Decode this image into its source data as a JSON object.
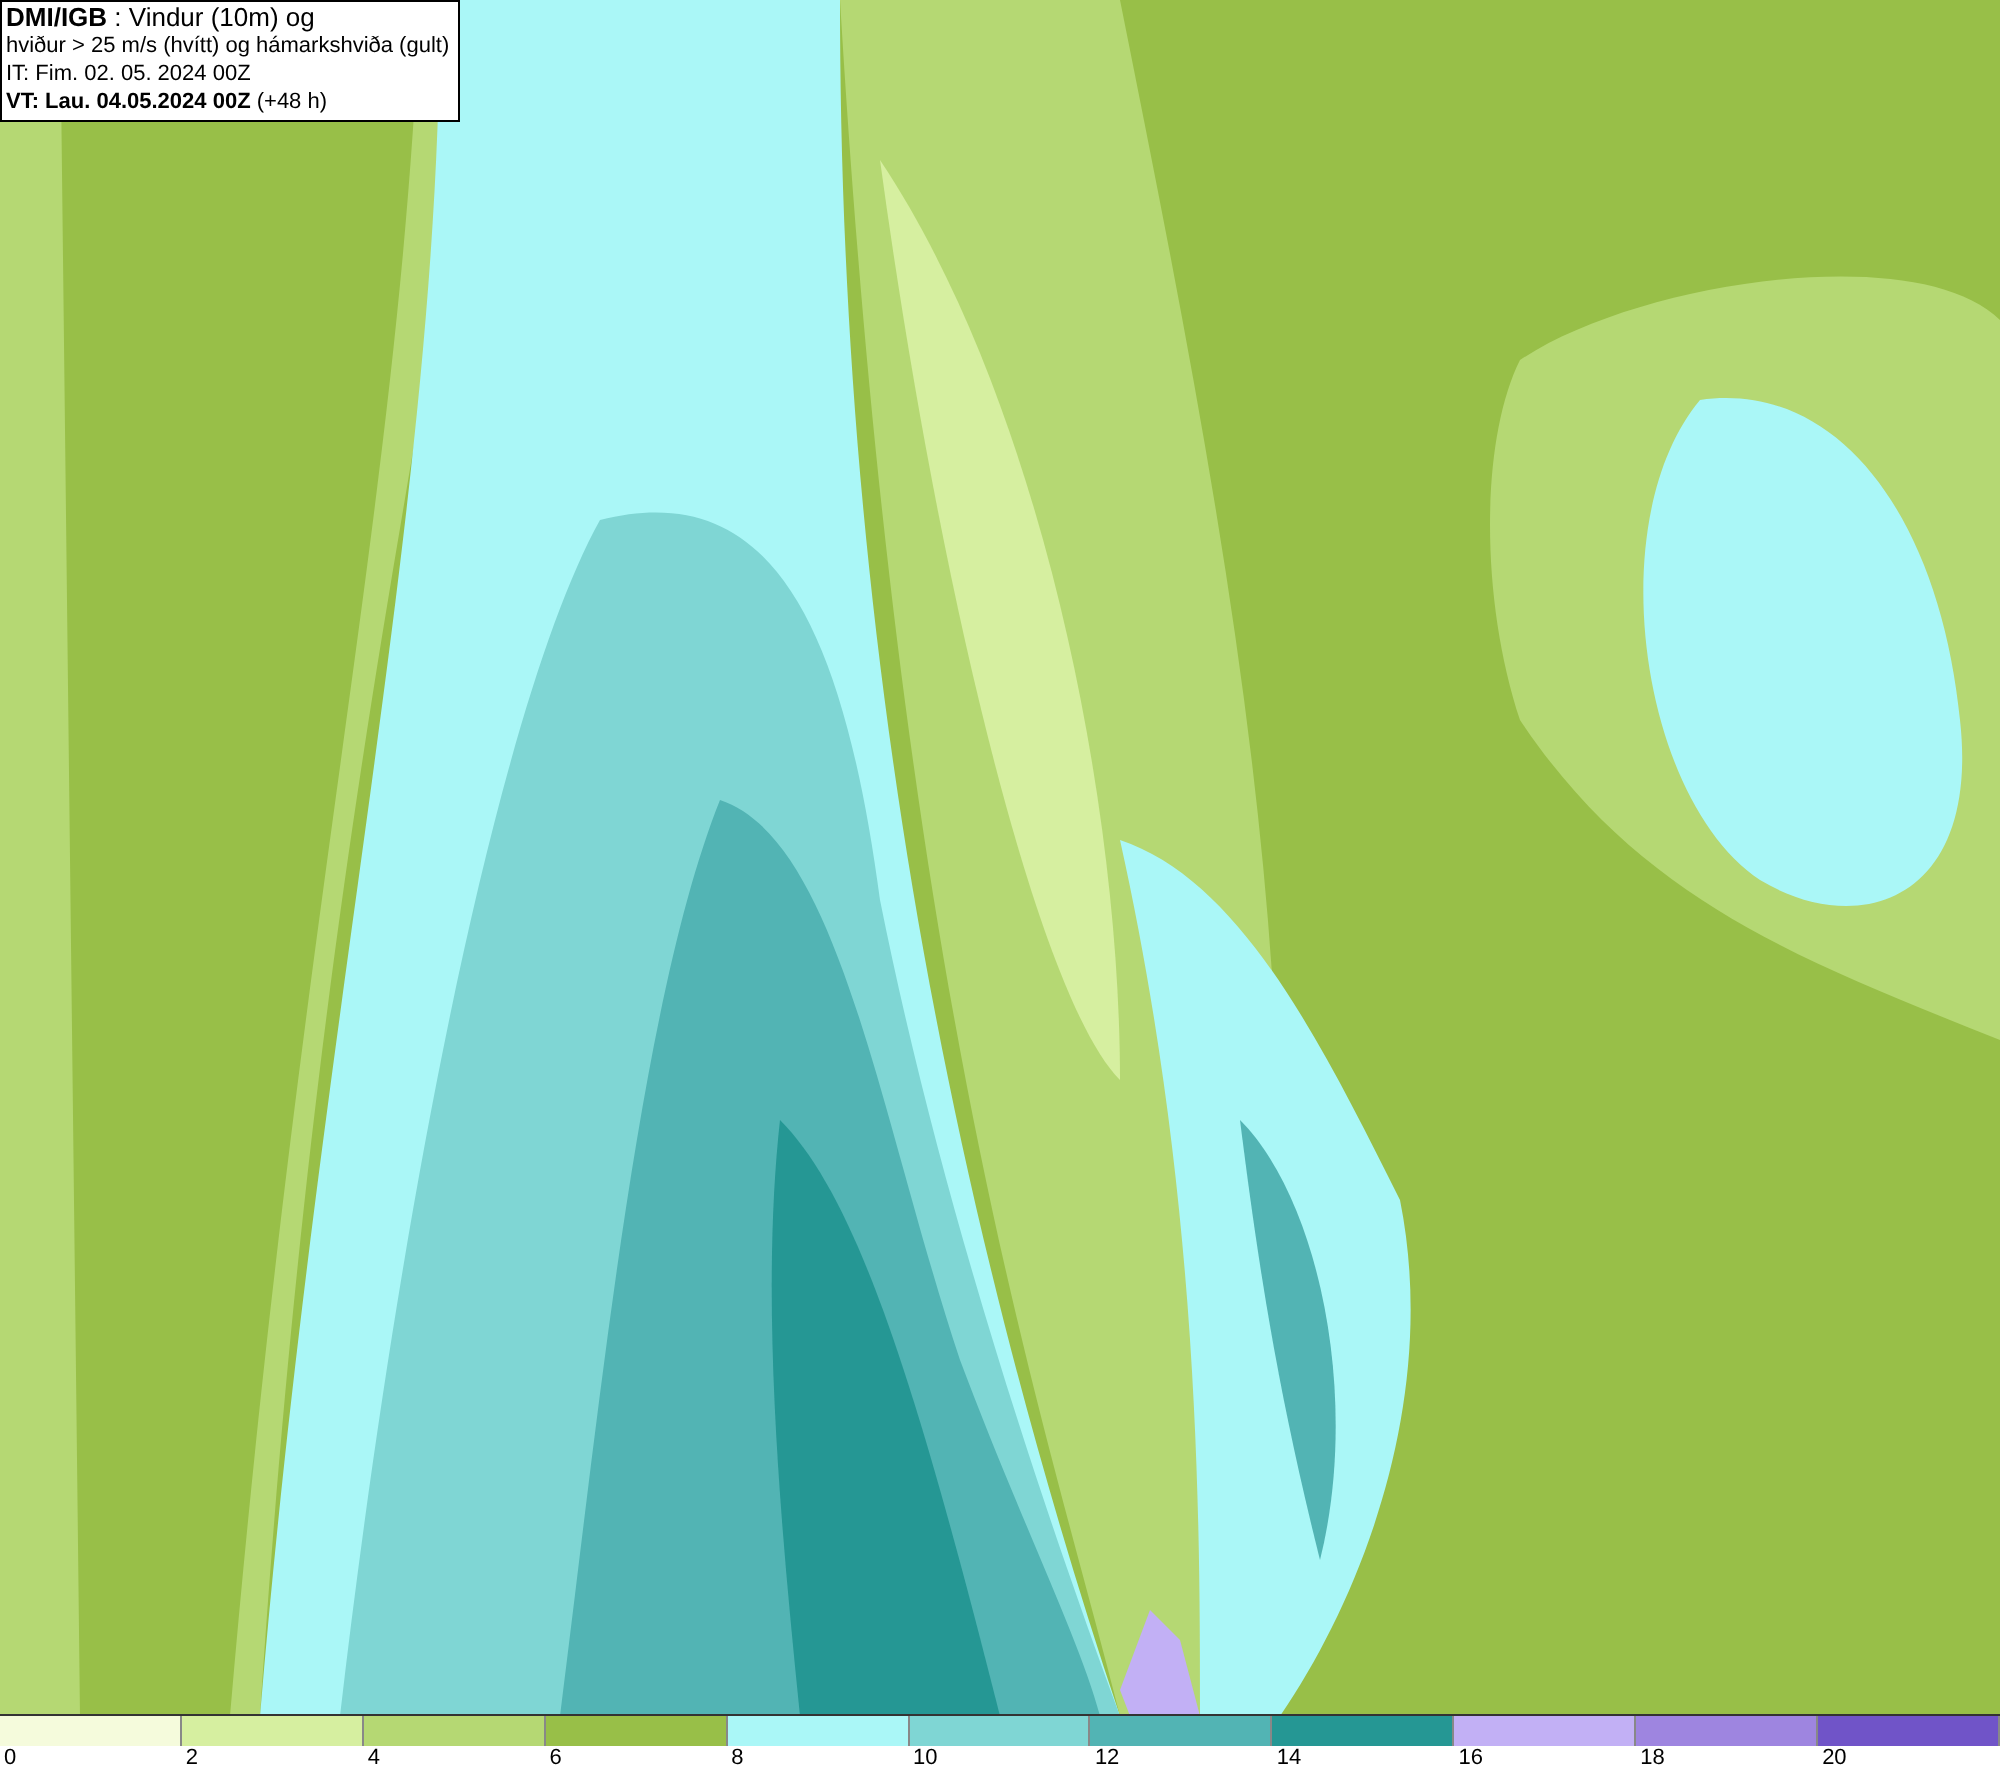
{
  "info_box": {
    "lines": [
      "**DMI/IGB** : Vindur (10m) og",
      "hviður > 25 m/s (hvítt) og hámarkshviða (gult)",
      "IT: Fim. 02. 05. 2024 00Z",
      "**VT: Lau. 04.05.2024 00Z** (+48 h)"
    ]
  },
  "legend": {
    "segments": [
      {
        "color": "#f5fbdc"
      },
      {
        "color": "#d6efa0"
      },
      {
        "color": "#b5d873"
      },
      {
        "color": "#98bf48"
      },
      {
        "color": "#aaf7f7"
      },
      {
        "color": "#7fd6d4"
      },
      {
        "color": "#52b4b4"
      },
      {
        "color": "#259794"
      },
      {
        "color": "#c2b0f5"
      },
      {
        "color": "#9e85e0"
      },
      {
        "color": "#7054c8"
      }
    ],
    "ticks": [
      "0",
      "2",
      "4",
      "6",
      "8",
      "10",
      "12",
      "14",
      "16",
      "18",
      "20"
    ]
  }
}
